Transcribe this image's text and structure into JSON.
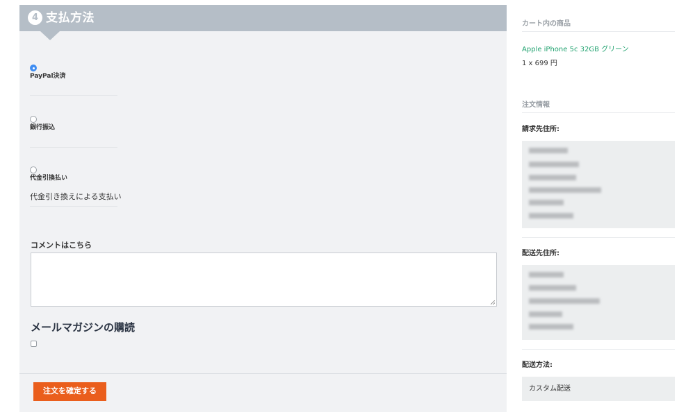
{
  "payment": {
    "step_number": "4",
    "title": "支払方法",
    "options": [
      {
        "label": "PayPal決済",
        "selected": true
      },
      {
        "label": "銀行振込",
        "selected": false
      },
      {
        "label": "代金引換払い",
        "selected": false,
        "description": "代金引き換えによる支払い"
      }
    ],
    "comment_label": "コメントはこちら",
    "comment_value": "",
    "newsletter_title": "メールマガジンの購読",
    "newsletter_checked": false,
    "confirm_label": "注文を確定する",
    "colors": {
      "header": "#b5bec7",
      "button": "#ea5e1c",
      "radio_selected": "#3f8df2"
    }
  },
  "summary": {
    "cart_heading": "カート内の商品",
    "product_name": "Apple iPhone 5c 32GB グリーン",
    "product_qty_price": "1 x 699 円",
    "order_info_heading": "注文情報",
    "billing_label": "請求先住所:",
    "shipping_label": "配送先住所:",
    "delivery_method_label": "配送方法:",
    "delivery_method_value": "カスタム配送",
    "colors": {
      "product_link": "#20a26f"
    }
  }
}
